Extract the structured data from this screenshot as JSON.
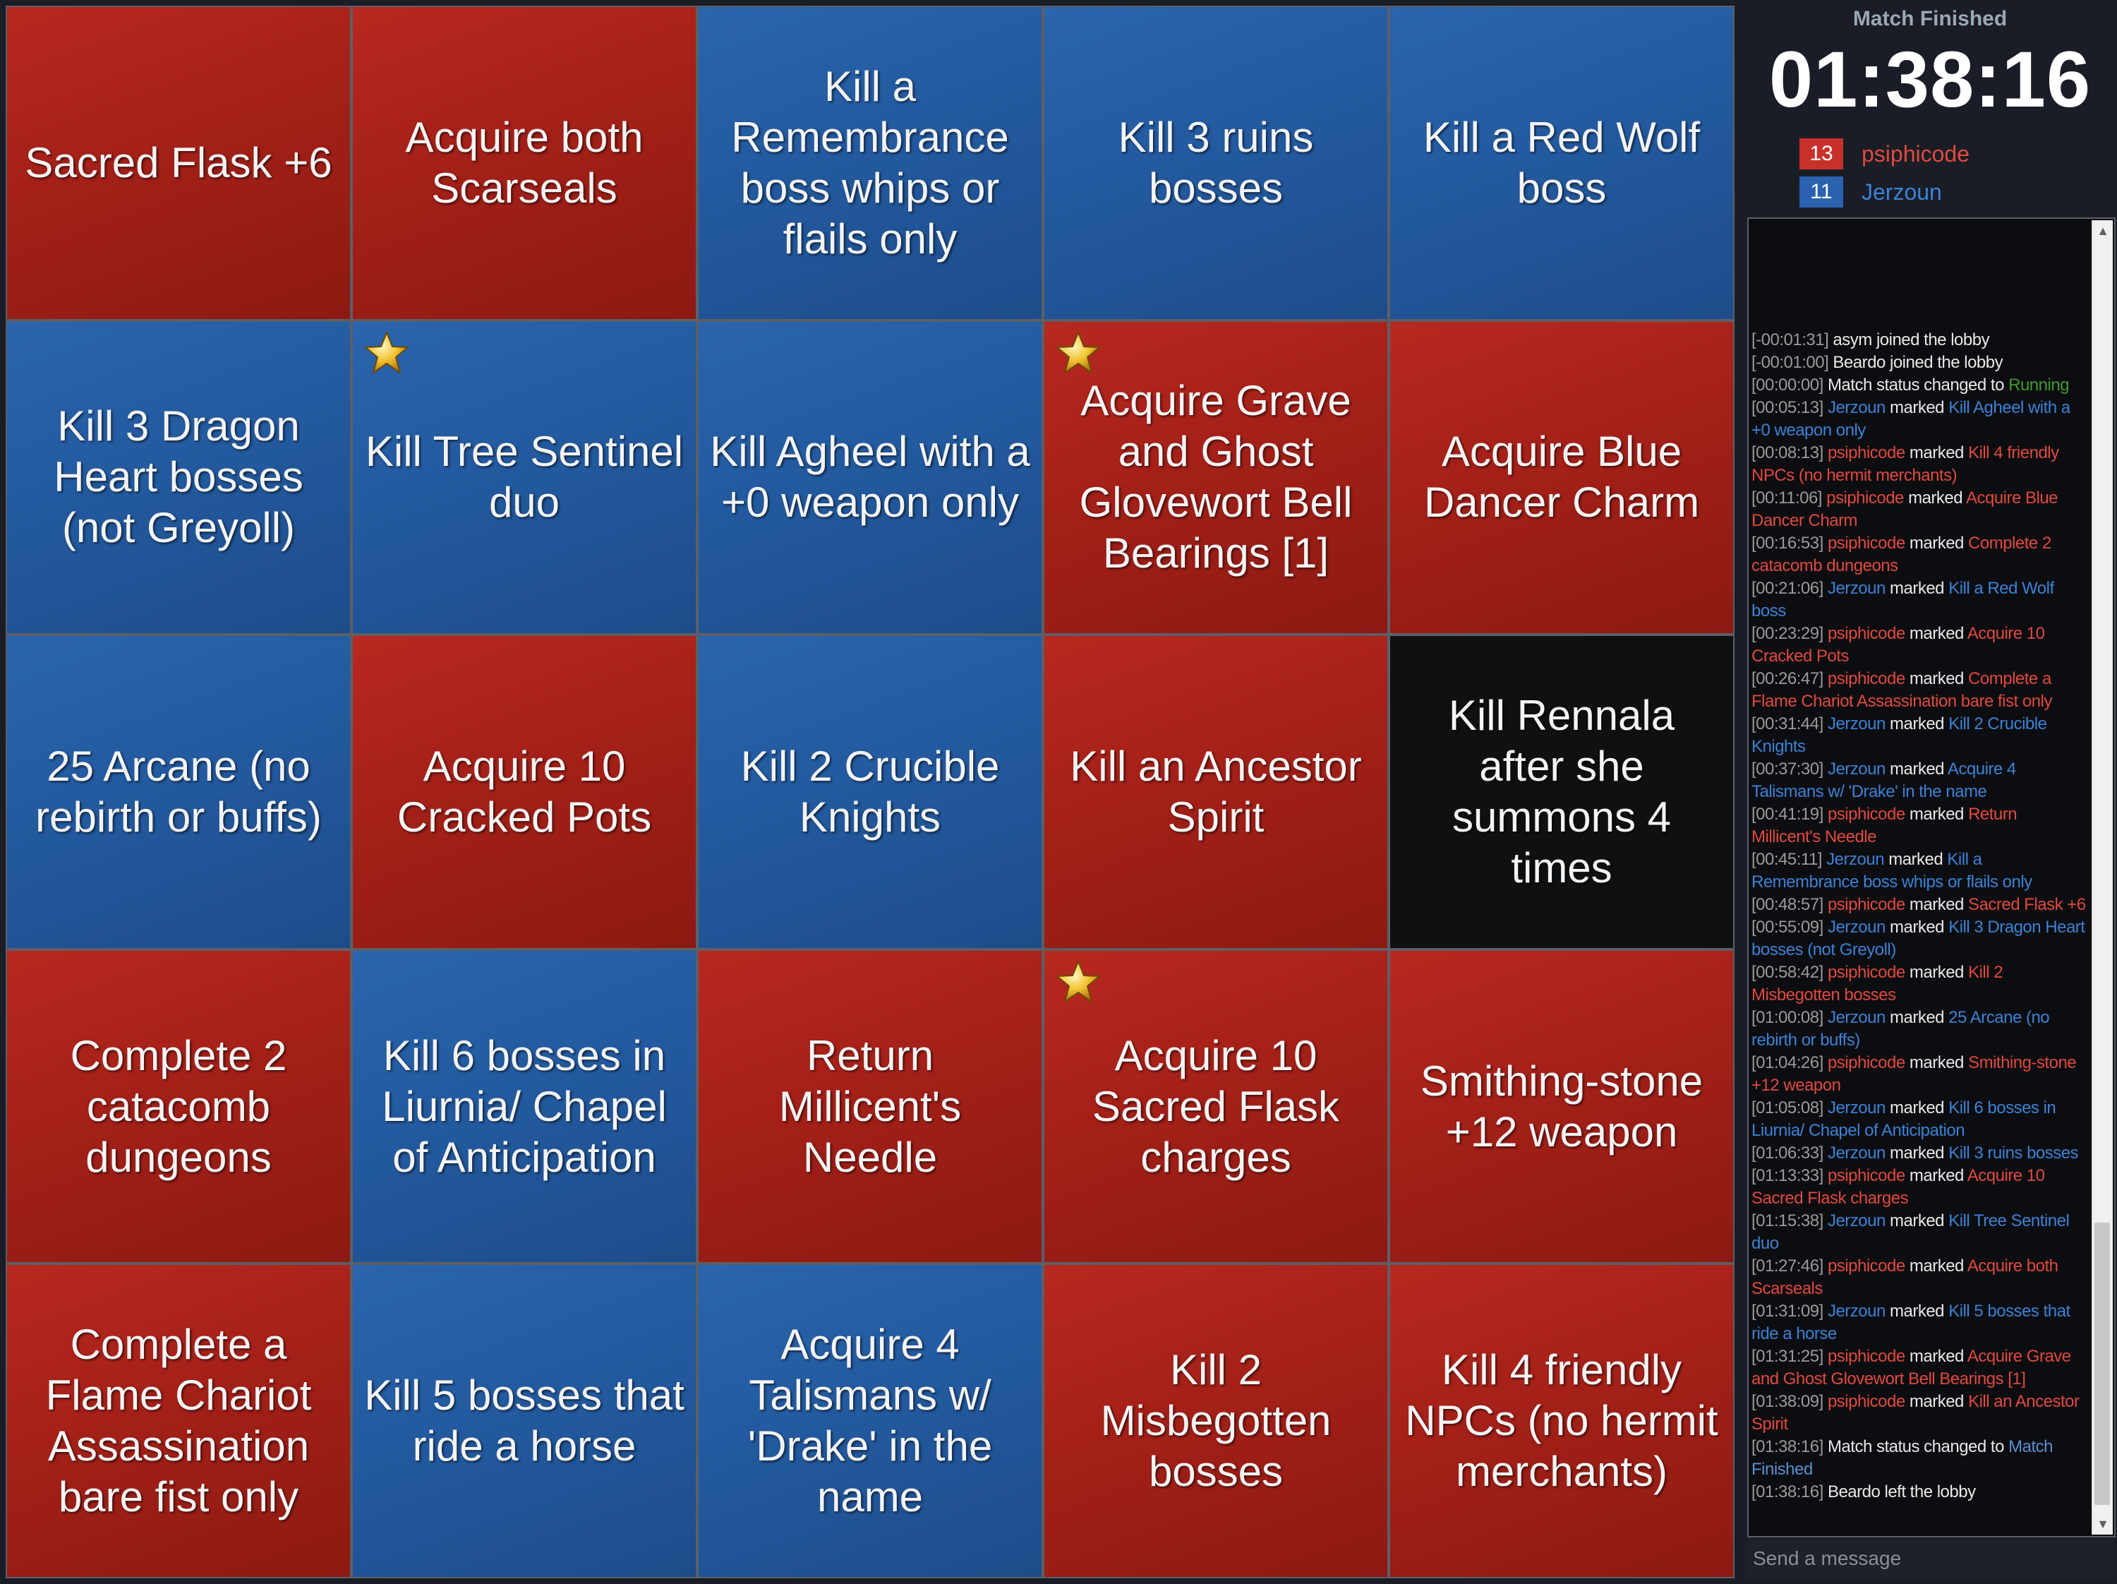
{
  "board": [
    {
      "text": "Sacred Flask +6",
      "color": "red",
      "star": false
    },
    {
      "text": "Acquire both Scarseals",
      "color": "red",
      "star": false
    },
    {
      "text": "Kill a Remembrance boss whips or flails only",
      "color": "blue",
      "star": false
    },
    {
      "text": "Kill 3 ruins bosses",
      "color": "blue",
      "star": false
    },
    {
      "text": "Kill a Red Wolf boss",
      "color": "blue",
      "star": false
    },
    {
      "text": "Kill 3 Dragon Heart bosses (not Greyoll)",
      "color": "blue",
      "star": false
    },
    {
      "text": "Kill Tree Sentinel duo",
      "color": "blue",
      "star": true
    },
    {
      "text": "Kill Agheel with a +0 weapon only",
      "color": "blue",
      "star": false
    },
    {
      "text": "Acquire Grave and Ghost Glovewort Bell Bearings [1]",
      "color": "red",
      "star": true
    },
    {
      "text": "Acquire Blue Dancer Charm",
      "color": "red",
      "star": false
    },
    {
      "text": "25 Arcane (no rebirth or buffs)",
      "color": "blue",
      "star": false
    },
    {
      "text": "Acquire 10 Cracked Pots",
      "color": "red",
      "star": false
    },
    {
      "text": "Kill 2 Crucible Knights",
      "color": "blue",
      "star": false
    },
    {
      "text": "Kill an Ancestor Spirit",
      "color": "red",
      "star": false
    },
    {
      "text": "Kill Rennala after she summons 4 times",
      "color": "black",
      "star": false
    },
    {
      "text": "Complete 2 catacomb dungeons",
      "color": "red",
      "star": false
    },
    {
      "text": "Kill 6 bosses in Liurnia/ Chapel of Anticipation",
      "color": "blue",
      "star": false
    },
    {
      "text": "Return Millicent's Needle",
      "color": "red",
      "star": false
    },
    {
      "text": "Acquire 10 Sacred Flask charges",
      "color": "red",
      "star": true
    },
    {
      "text": "Smithing-stone +12 weapon",
      "color": "red",
      "star": false
    },
    {
      "text": "Complete a Flame Chariot Assassination bare fist only",
      "color": "red",
      "star": false
    },
    {
      "text": "Kill 5 bosses that ride a horse",
      "color": "blue",
      "star": false
    },
    {
      "text": "Acquire 4 Talismans w/ 'Drake' in the name",
      "color": "blue",
      "star": false
    },
    {
      "text": "Kill 2 Misbegotten bosses",
      "color": "red",
      "star": false
    },
    {
      "text": "Kill 4 friendly NPCs (no hermit merchants)",
      "color": "red",
      "star": false
    }
  ],
  "sidebar": {
    "status": "Match Finished",
    "timer": "01:38:16",
    "players": [
      {
        "score": "13",
        "name": "psiphicode",
        "color": "#c8302a",
        "text_color": "#e04a3e"
      },
      {
        "score": "11",
        "name": "Jerzoun",
        "color": "#2a62b0",
        "text_color": "#3b82d6"
      }
    ]
  },
  "chat": {
    "messages": [
      {
        "ts": "[-00:01:31]",
        "name": "asym",
        "name_color": "plain",
        "action": "joined the lobby",
        "object": "",
        "object_color": ""
      },
      {
        "ts": "[-00:01:00]",
        "name": "Beardo",
        "name_color": "plain",
        "action": "joined the lobby",
        "object": "",
        "object_color": ""
      },
      {
        "ts": "[00:00:00]",
        "name": "Match",
        "name_color": "plain",
        "action": "status changed to",
        "object": "Running",
        "object_color": "green"
      },
      {
        "ts": "[00:05:13]",
        "name": "Jerzoun",
        "name_color": "blue",
        "action": "marked",
        "object": "Kill Agheel with a +0 weapon only",
        "object_color": "blue"
      },
      {
        "ts": "[00:08:13]",
        "name": "psiphicode",
        "name_color": "red",
        "action": "marked",
        "object": "Kill 4 friendly NPCs (no hermit merchants)",
        "object_color": "red"
      },
      {
        "ts": "[00:11:06]",
        "name": "psiphicode",
        "name_color": "red",
        "action": "marked",
        "object": "Acquire Blue Dancer Charm",
        "object_color": "red"
      },
      {
        "ts": "[00:16:53]",
        "name": "psiphicode",
        "name_color": "red",
        "action": "marked",
        "object": "Complete 2 catacomb dungeons",
        "object_color": "red"
      },
      {
        "ts": "[00:21:06]",
        "name": "Jerzoun",
        "name_color": "blue",
        "action": "marked",
        "object": "Kill a Red Wolf boss",
        "object_color": "blue"
      },
      {
        "ts": "[00:23:29]",
        "name": "psiphicode",
        "name_color": "red",
        "action": "marked",
        "object": "Acquire 10 Cracked Pots",
        "object_color": "red"
      },
      {
        "ts": "[00:26:47]",
        "name": "psiphicode",
        "name_color": "red",
        "action": "marked",
        "object": "Complete a Flame Chariot Assassination bare fist only",
        "object_color": "red"
      },
      {
        "ts": "[00:31:44]",
        "name": "Jerzoun",
        "name_color": "blue",
        "action": "marked",
        "object": "Kill 2 Crucible Knights",
        "object_color": "blue"
      },
      {
        "ts": "[00:37:30]",
        "name": "Jerzoun",
        "name_color": "blue",
        "action": "marked",
        "object": "Acquire 4 Talismans w/ 'Drake' in the name",
        "object_color": "blue"
      },
      {
        "ts": "[00:41:19]",
        "name": "psiphicode",
        "name_color": "red",
        "action": "marked",
        "object": "Return Millicent's Needle",
        "object_color": "red"
      },
      {
        "ts": "[00:45:11]",
        "name": "Jerzoun",
        "name_color": "blue",
        "action": "marked",
        "object": "Kill a Remembrance boss whips or flails only",
        "object_color": "blue"
      },
      {
        "ts": "[00:48:57]",
        "name": "psiphicode",
        "name_color": "red",
        "action": "marked",
        "object": "Sacred Flask +6",
        "object_color": "red"
      },
      {
        "ts": "[00:55:09]",
        "name": "Jerzoun",
        "name_color": "blue",
        "action": "marked",
        "object": "Kill 3 Dragon Heart bosses (not Greyoll)",
        "object_color": "blue"
      },
      {
        "ts": "[00:58:42]",
        "name": "psiphicode",
        "name_color": "red",
        "action": "marked",
        "object": "Kill 2 Misbegotten bosses",
        "object_color": "red"
      },
      {
        "ts": "[01:00:08]",
        "name": "Jerzoun",
        "name_color": "blue",
        "action": "marked",
        "object": "25 Arcane (no rebirth or buffs)",
        "object_color": "blue"
      },
      {
        "ts": "[01:04:26]",
        "name": "psiphicode",
        "name_color": "red",
        "action": "marked",
        "object": "Smithing-stone +12 weapon",
        "object_color": "red"
      },
      {
        "ts": "[01:05:08]",
        "name": "Jerzoun",
        "name_color": "blue",
        "action": "marked",
        "object": "Kill 6 bosses in Liurnia/ Chapel of Anticipation",
        "object_color": "blue"
      },
      {
        "ts": "[01:06:33]",
        "name": "Jerzoun",
        "name_color": "blue",
        "action": "marked",
        "object": "Kill 3 ruins bosses",
        "object_color": "blue"
      },
      {
        "ts": "[01:13:33]",
        "name": "psiphicode",
        "name_color": "red",
        "action": "marked",
        "object": "Acquire 10 Sacred Flask charges",
        "object_color": "red"
      },
      {
        "ts": "[01:15:38]",
        "name": "Jerzoun",
        "name_color": "blue",
        "action": "marked",
        "object": "Kill Tree Sentinel duo",
        "object_color": "blue"
      },
      {
        "ts": "[01:27:46]",
        "name": "psiphicode",
        "name_color": "red",
        "action": "marked",
        "object": "Acquire both Scarseals",
        "object_color": "red"
      },
      {
        "ts": "[01:31:09]",
        "name": "Jerzoun",
        "name_color": "blue",
        "action": "marked",
        "object": "Kill 5 bosses that ride a horse",
        "object_color": "blue"
      },
      {
        "ts": "[01:31:25]",
        "name": "psiphicode",
        "name_color": "red",
        "action": "marked",
        "object": "Acquire Grave and Ghost Glovewort Bell Bearings [1]",
        "object_color": "red"
      },
      {
        "ts": "[01:38:09]",
        "name": "psiphicode",
        "name_color": "red",
        "action": "marked",
        "object": "Kill an Ancestor Spirit",
        "object_color": "red"
      },
      {
        "ts": "[01:38:16]",
        "name": "Match",
        "name_color": "plain",
        "action": "status changed to",
        "object": "Match Finished",
        "object_color": "blue2"
      },
      {
        "ts": "[01:38:16]",
        "name": "Beardo",
        "name_color": "plain",
        "action": "left the lobby",
        "object": "",
        "object_color": ""
      }
    ],
    "input_placeholder": "Send a message",
    "scroll_up_icon": "chevron-up-icon",
    "scroll_down_icon": "chevron-down-icon"
  }
}
